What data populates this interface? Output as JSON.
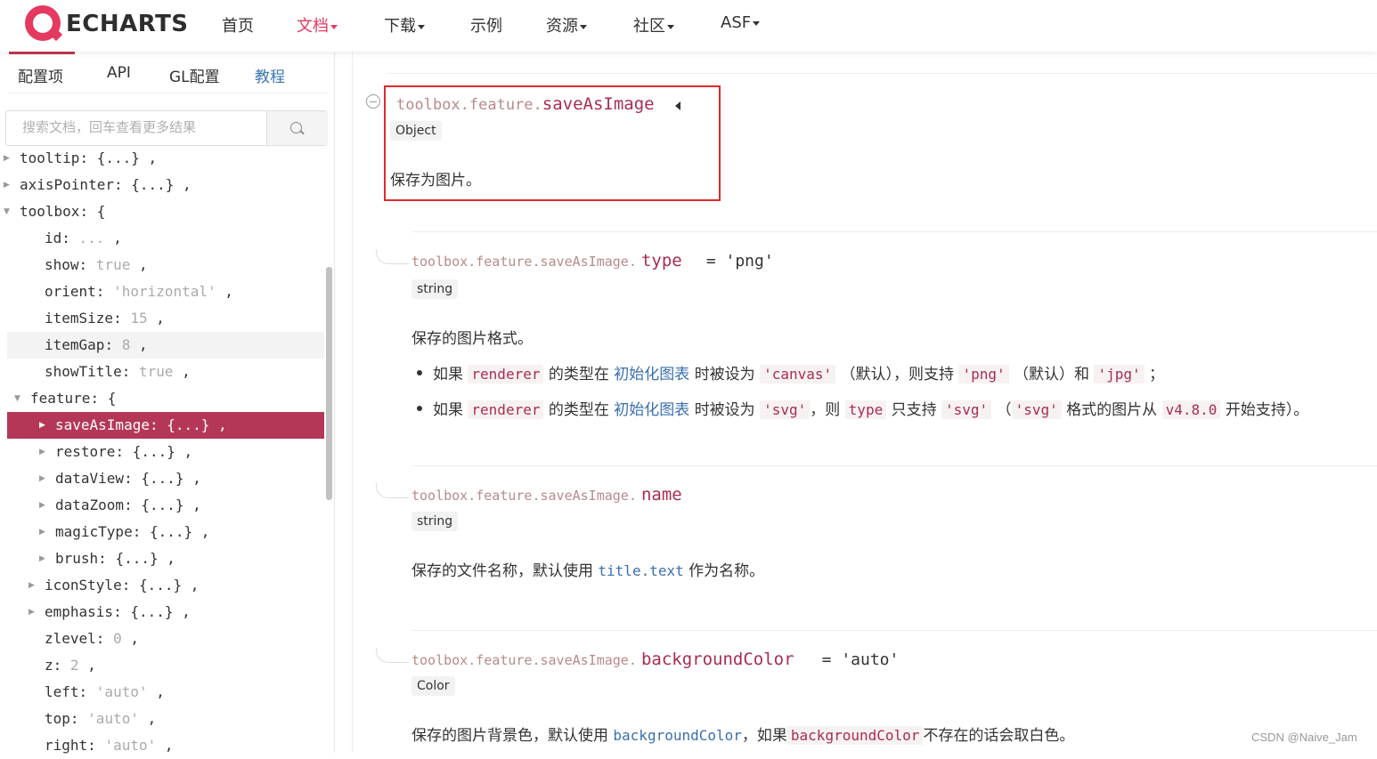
{
  "nav": {
    "logo_text": "ECHARTS",
    "items": [
      {
        "label": "首页",
        "dropdown": false
      },
      {
        "label": "文档",
        "dropdown": true,
        "active": true
      },
      {
        "label": "下载",
        "dropdown": true
      },
      {
        "label": "示例",
        "dropdown": false
      },
      {
        "label": "资源",
        "dropdown": true
      },
      {
        "label": "社区",
        "dropdown": true
      },
      {
        "label": "ASF",
        "dropdown": true
      }
    ]
  },
  "sidebar": {
    "tabs": [
      "配置项",
      "API",
      "GL配置",
      "教程"
    ],
    "search_placeholder": "搜索文档，回车查看更多结果",
    "tree": [
      {
        "key": "tooltip",
        "value": "{...}",
        "comma": " ,"
      },
      {
        "key": "axisPointer",
        "value": "{...}",
        "comma": " ,"
      },
      {
        "key": "toolbox",
        "value": "{",
        "comma": ""
      },
      {
        "key": "id",
        "value": "...",
        "comma": " ,"
      },
      {
        "key": "show",
        "value": "true",
        "comma": " ,"
      },
      {
        "key": "orient",
        "value": "'horizontal'",
        "comma": " ,"
      },
      {
        "key": "itemSize",
        "value": "15",
        "comma": " ,"
      },
      {
        "key": "itemGap",
        "value": "8",
        "comma": " ,"
      },
      {
        "key": "showTitle",
        "value": "true",
        "comma": " ,"
      },
      {
        "key": "feature",
        "value": "{",
        "comma": ""
      },
      {
        "key": "saveAsImage",
        "value": "{...}",
        "comma": " ,"
      },
      {
        "key": "restore",
        "value": "{...}",
        "comma": " ,"
      },
      {
        "key": "dataView",
        "value": "{...}",
        "comma": " ,"
      },
      {
        "key": "dataZoom",
        "value": "{...}",
        "comma": " ,"
      },
      {
        "key": "magicType",
        "value": "{...}",
        "comma": " ,"
      },
      {
        "key": "brush",
        "value": "{...}",
        "comma": " ,"
      },
      {
        "key": "iconStyle",
        "value": "{...}",
        "comma": " ,"
      },
      {
        "key": "emphasis",
        "value": "{...}",
        "comma": " ,"
      },
      {
        "key": "zlevel",
        "value": "0",
        "comma": " ,"
      },
      {
        "key": "z",
        "value": "2",
        "comma": " ,"
      },
      {
        "key": "left",
        "value": "'auto'",
        "comma": " ,"
      },
      {
        "key": "top",
        "value": "'auto'",
        "comma": " ,"
      },
      {
        "key": "right",
        "value": "'auto'",
        "comma": " ,"
      }
    ]
  },
  "content": {
    "main": {
      "prefix": "toolbox.feature.",
      "name": "saveAsImage",
      "type": "Object",
      "desc": "保存为图片。"
    },
    "type_prop": {
      "prefix": "toolbox.feature.saveAsImage.",
      "name": "type",
      "default": "= 'png'",
      "type": "string",
      "desc": "保存的图片格式。",
      "bullet1": {
        "p1": "如果",
        "c1": "renderer",
        "p2": "的类型在",
        "link": "初始化图表",
        "p3": "时被设为",
        "c2": "'canvas'",
        "p4": "（默认），则支持",
        "c3": "'png'",
        "p5": "（默认）和",
        "c4": "'jpg'",
        "p6": "；"
      },
      "bullet2": {
        "p1": "如果",
        "c1": "renderer",
        "p2": "的类型在",
        "link": "初始化图表",
        "p3": "时被设为",
        "c2": "'svg'",
        "p4": "，则",
        "c3": "type",
        "p5": "只支持",
        "c4": "'svg'",
        "p6": "（",
        "c5": "'svg'",
        "p7": "格式的图片从",
        "c6": "v4.8.0",
        "p8": "开始支持）。"
      }
    },
    "name_prop": {
      "prefix": "toolbox.feature.saveAsImage.",
      "name": "name",
      "type": "string",
      "desc_a": "保存的文件名称，默认使用",
      "desc_code": "title.text",
      "desc_b": "作为名称。"
    },
    "bg_prop": {
      "prefix": "toolbox.feature.saveAsImage.",
      "name": "backgroundColor",
      "default": "= 'auto'",
      "type": "Color",
      "desc_a": "保存的图片背景色，默认使用",
      "desc_code1": "backgroundColor",
      "desc_b": "，如果",
      "desc_code2": "backgroundColor",
      "desc_c": "不存在的话会取白色。"
    }
  },
  "watermark": "CSDN @Naive_Jam",
  "colors": {
    "brand": "#e43961",
    "selected_row": "#b43757",
    "link": "#3a6fb0",
    "highlight_box": "#e02a2a"
  }
}
